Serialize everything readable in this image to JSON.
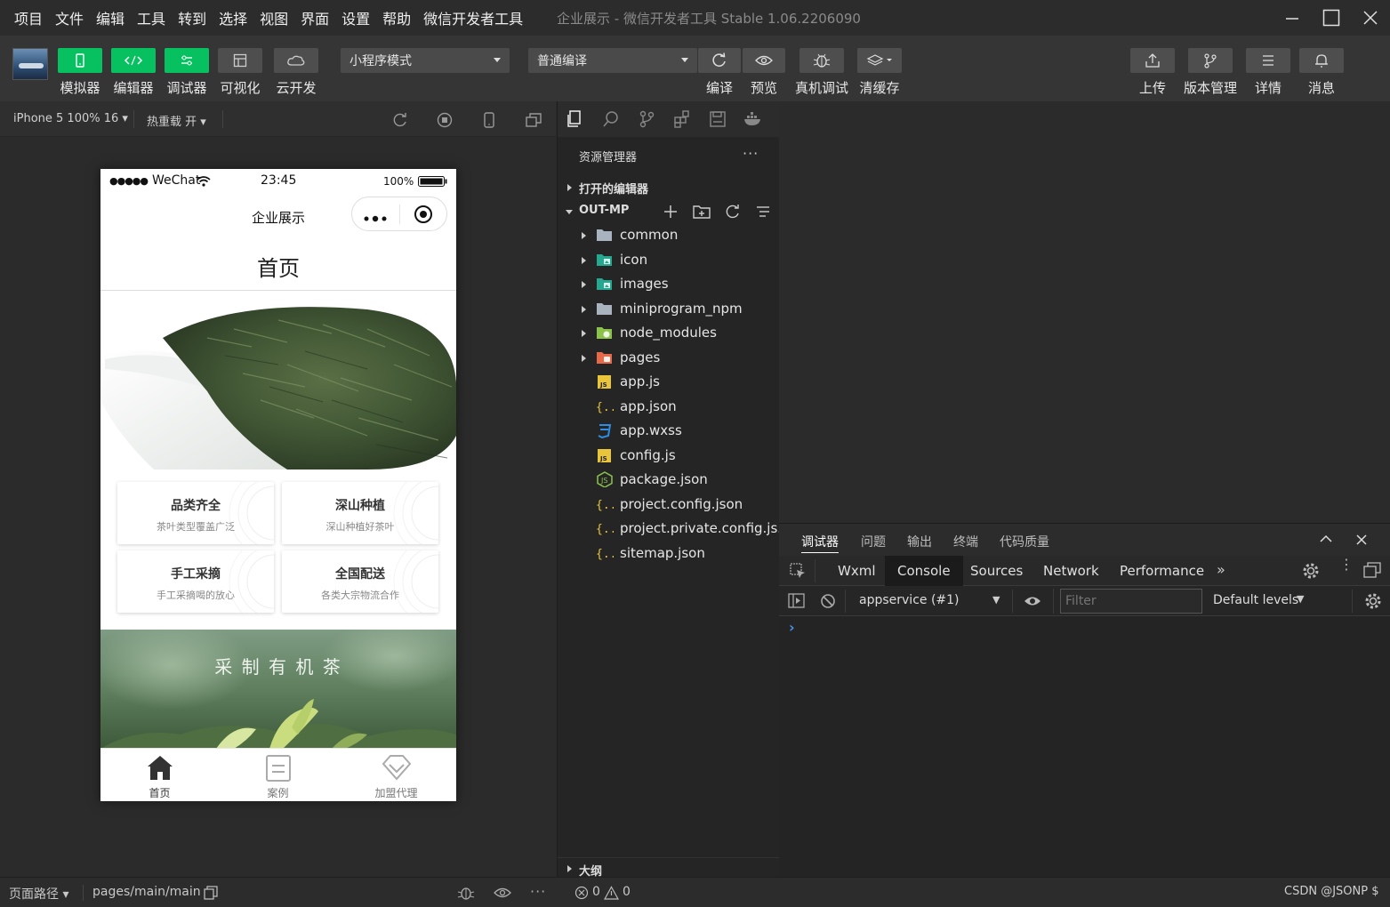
{
  "window": {
    "menu": [
      "项目",
      "文件",
      "编辑",
      "工具",
      "转到",
      "选择",
      "视图",
      "界面",
      "设置",
      "帮助",
      "微信开发者工具"
    ],
    "title": "企业展示 - 微信开发者工具 Stable 1.06.2206090"
  },
  "toolbar": {
    "left_buttons": [
      {
        "label": "模拟器",
        "icon": "phone-icon",
        "style": "green"
      },
      {
        "label": "编辑器",
        "icon": "code-icon",
        "style": "green"
      },
      {
        "label": "调试器",
        "icon": "sliders-icon",
        "style": "green"
      },
      {
        "label": "可视化",
        "icon": "layout-icon",
        "style": "gray"
      },
      {
        "label": "云开发",
        "icon": "cloud-icon",
        "style": "gray"
      }
    ],
    "mode_select": "小程序模式",
    "compile_select": "普通编译",
    "compile_actions": [
      {
        "label": "编译",
        "icon": "refresh-icon"
      },
      {
        "label": "预览",
        "icon": "eye-icon"
      },
      {
        "label": "真机调试",
        "icon": "bug-icon"
      },
      {
        "label": "清缓存",
        "icon": "layers-icon"
      }
    ],
    "right_buttons": [
      {
        "label": "上传",
        "icon": "upload-icon"
      },
      {
        "label": "版本管理",
        "icon": "branch-icon"
      },
      {
        "label": "详情",
        "icon": "menu-icon"
      },
      {
        "label": "消息",
        "icon": "bell-icon"
      }
    ]
  },
  "simulator": {
    "device_select": "iPhone 5 100% 16",
    "hot_reload": "热重载 开",
    "phone": {
      "status_signal": "●●●●●",
      "status_carrier": "WeChat",
      "status_time": "23:45",
      "status_battery": "100%",
      "nav_title": "企业展示",
      "page_heading": "首页",
      "cards": [
        {
          "title": "品类齐全",
          "subtitle": "茶叶类型覆盖广泛"
        },
        {
          "title": "深山种植",
          "subtitle": "深山种植好茶叶"
        },
        {
          "title": "手工采摘",
          "subtitle": "手工采摘喝的放心"
        },
        {
          "title": "全国配送",
          "subtitle": "各类大宗物流合作"
        }
      ],
      "banner_text": "采 制 有 机 茶",
      "tabbar": [
        {
          "label": "首页",
          "icon": "home-icon",
          "active": true
        },
        {
          "label": "案例",
          "icon": "document-icon",
          "active": false
        },
        {
          "label": "加盟代理",
          "icon": "diamond-icon",
          "active": false
        }
      ]
    }
  },
  "explorer": {
    "title": "资源管理器",
    "open_editors": "打开的编辑器",
    "project": "OUT-MP",
    "outline": "大纲",
    "files": [
      {
        "name": "common",
        "kind": "folder",
        "color": "#a8b3bf",
        "expandable": true
      },
      {
        "name": "icon",
        "kind": "folder-image",
        "color": "#24a88f",
        "expandable": true
      },
      {
        "name": "images",
        "kind": "folder-image",
        "color": "#24a88f",
        "expandable": true
      },
      {
        "name": "miniprogram_npm",
        "kind": "folder",
        "color": "#a8b3bf",
        "expandable": true
      },
      {
        "name": "node_modules",
        "kind": "folder-node",
        "color": "#8bc34a",
        "expandable": true
      },
      {
        "name": "pages",
        "kind": "folder-pages",
        "color": "#e8684a",
        "expandable": true
      },
      {
        "name": "app.js",
        "kind": "js",
        "color": "#e8c53a",
        "expandable": false
      },
      {
        "name": "app.json",
        "kind": "json",
        "color": "#e8c53a",
        "expandable": false
      },
      {
        "name": "app.wxss",
        "kind": "css",
        "color": "#2e8ee6",
        "expandable": false
      },
      {
        "name": "config.js",
        "kind": "js",
        "color": "#e8c53a",
        "expandable": false
      },
      {
        "name": "package.json",
        "kind": "npm",
        "color": "#8bc34a",
        "expandable": false
      },
      {
        "name": "project.config.json",
        "kind": "json",
        "color": "#e8c53a",
        "expandable": false
      },
      {
        "name": "project.private.config.js...",
        "kind": "json",
        "color": "#e8c53a",
        "expandable": false
      },
      {
        "name": "sitemap.json",
        "kind": "json",
        "color": "#e8c53a",
        "expandable": false
      }
    ]
  },
  "debugger": {
    "panel_tabs": [
      "调试器",
      "问题",
      "输出",
      "终端",
      "代码质量"
    ],
    "devtools_tabs": [
      "Wxml",
      "Console",
      "Sources",
      "Network",
      "Performance"
    ],
    "active_devtools_tab": "Console",
    "context_select": "appservice (#1)",
    "filter_placeholder": "Filter",
    "levels_select": "Default levels",
    "prompt": "›"
  },
  "statusbar": {
    "page_path_label": "页面路径",
    "page_path": "pages/main/main",
    "errors": "0",
    "warnings": "0",
    "watermark": "CSDN @JSONP $"
  }
}
